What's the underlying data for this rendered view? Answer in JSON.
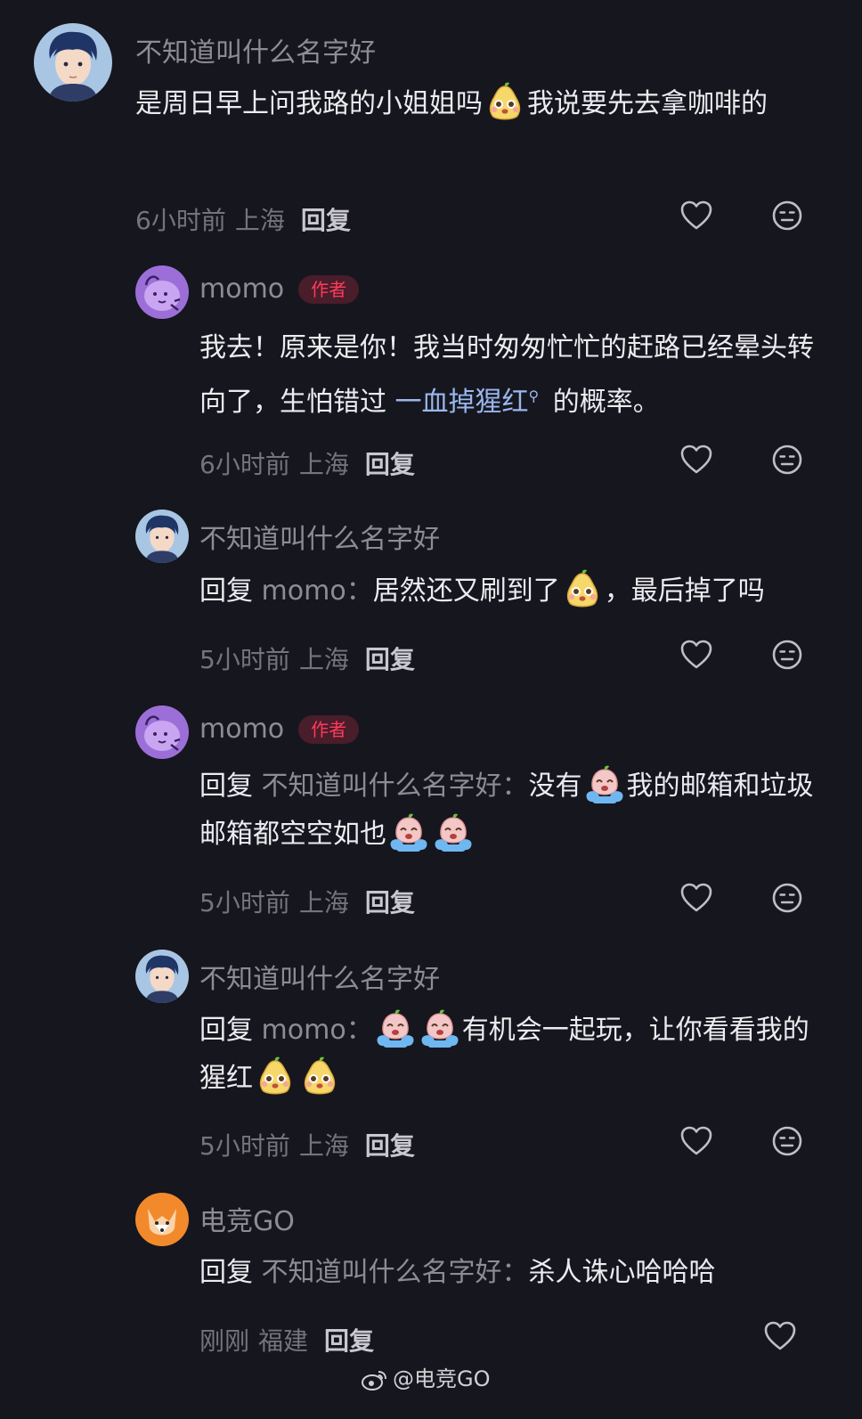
{
  "comments": [
    {
      "user": "不知道叫什么名字好",
      "text_a": "是周日早上问我路的小姐姐吗",
      "text_b": "我说要先去拿咖啡的",
      "time": "6小时前",
      "location": "上海",
      "reply_label": "回复"
    },
    {
      "user": "momo",
      "badge": "作者",
      "text_a": "我去！原来是你！我当时匆匆忙忙的赶路已经晕头转向了，生怕错过 ",
      "highlight": "一血掉猩红",
      "text_b": " 的概率。",
      "time": "6小时前",
      "location": "上海",
      "reply_label": "回复"
    },
    {
      "user": "不知道叫什么名字好",
      "reply_prefix": "回复",
      "reply_target": "momo：",
      "text_a": "居然还又刷到了",
      "text_b": "，最后掉了吗",
      "time": "5小时前",
      "location": "上海",
      "reply_label": "回复"
    },
    {
      "user": "momo",
      "badge": "作者",
      "reply_prefix": "回复",
      "reply_target": "不知道叫什么名字好：",
      "text_a": "没有",
      "text_b": "我的邮箱和垃圾邮箱都空空如也",
      "time": "5小时前",
      "location": "上海",
      "reply_label": "回复"
    },
    {
      "user": "不知道叫什么名字好",
      "reply_prefix": "回复",
      "reply_target": "momo：",
      "text_a": "有机会一起玩，让你看看我的猩红",
      "time": "5小时前",
      "location": "上海",
      "reply_label": "回复"
    },
    {
      "user": "电竞GO",
      "reply_prefix": "回复",
      "reply_target": "不知道叫什么名字好：",
      "text_a": "杀人诛心哈哈哈",
      "time": "刚刚",
      "location": "福建",
      "reply_label": "回复"
    }
  ],
  "watermark": "@电竞GO",
  "icons": {
    "like": "heart-outline-icon",
    "emoji_react": "neutral-face-icon",
    "emoji_pear": "pear-face-emoji",
    "emoji_cry": "crying-face-emoji",
    "search_hint": "search-icon"
  },
  "colors": {
    "background": "#16161e",
    "username": "#8d8c95",
    "author_badge": "#ff3b5c",
    "link": "#9ab7ee"
  }
}
